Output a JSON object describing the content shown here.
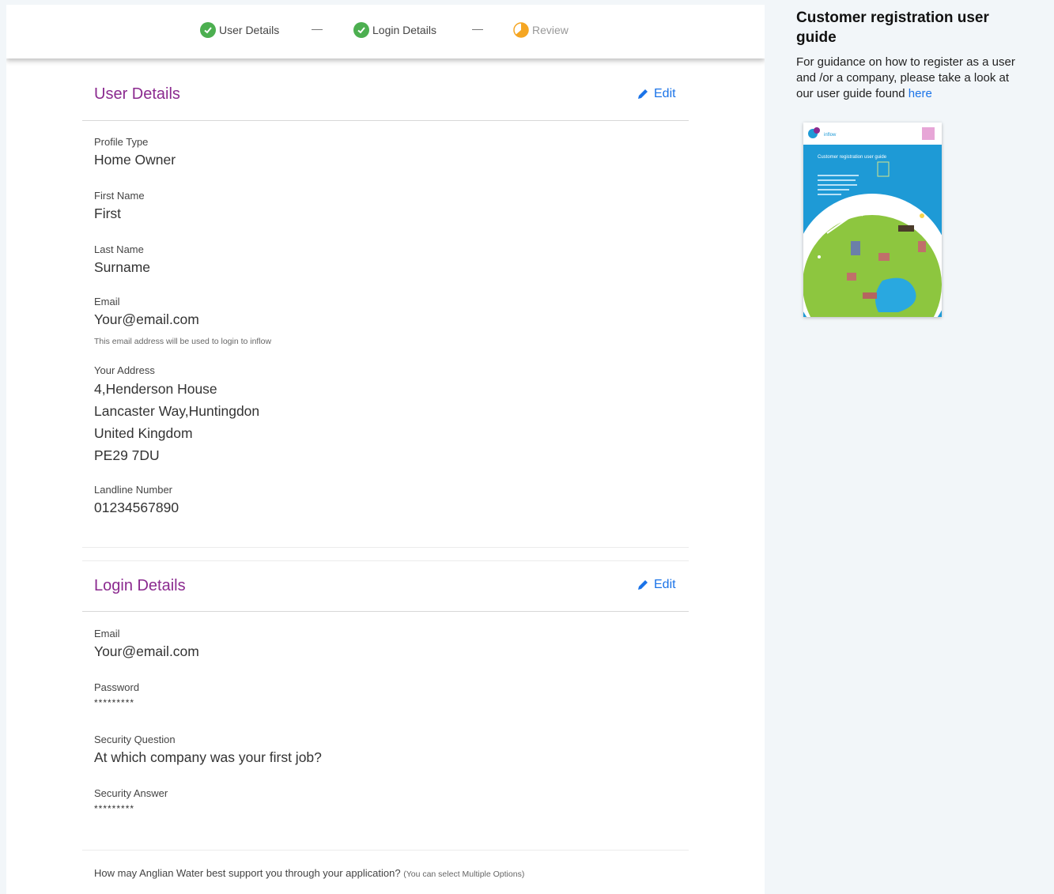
{
  "stepper": {
    "steps": [
      {
        "label": "User Details",
        "status": "complete"
      },
      {
        "label": "Login Details",
        "status": "complete"
      },
      {
        "label": "Review",
        "status": "current"
      }
    ],
    "separator": "---"
  },
  "user_details": {
    "title": "User Details",
    "edit_label": "Edit",
    "profile_type": {
      "label": "Profile Type",
      "value": "Home Owner"
    },
    "first_name": {
      "label": "First Name",
      "value": "First"
    },
    "last_name": {
      "label": "Last Name",
      "value": "Surname"
    },
    "email": {
      "label": "Email",
      "value": "Your@email.com",
      "hint": "This email address will be used to login to inflow"
    },
    "address": {
      "label": "Your Address",
      "lines": [
        "4,Henderson House",
        "Lancaster Way,Huntingdon",
        "United Kingdom",
        "PE29 7DU"
      ]
    },
    "landline": {
      "label": "Landline Number",
      "value": "01234567890"
    }
  },
  "login_details": {
    "title": "Login Details",
    "edit_label": "Edit",
    "email": {
      "label": "Email",
      "value": "Your@email.com"
    },
    "password": {
      "label": "Password",
      "value": "*********"
    },
    "security_question": {
      "label": "Security Question",
      "value": "At which company was your first job?"
    },
    "security_answer": {
      "label": "Security Answer",
      "value": "*********"
    }
  },
  "support": {
    "question": "How may Anglian Water best support you through your application?",
    "note": "(You can select Multiple Options)"
  },
  "guide": {
    "title": "Customer registration user guide",
    "text": "For guidance on how to register as a user and /or a company, please take a look at our user guide found",
    "link": "here",
    "thumbnail": {
      "brand": "inflow",
      "title": "Customer registration user guide"
    }
  },
  "colors": {
    "accent_purple": "#8b2a8f",
    "link_blue": "#1a73e8",
    "step_done": "#4caf50",
    "step_current": "#f5a623",
    "guide_blue": "#1e9ad6"
  }
}
